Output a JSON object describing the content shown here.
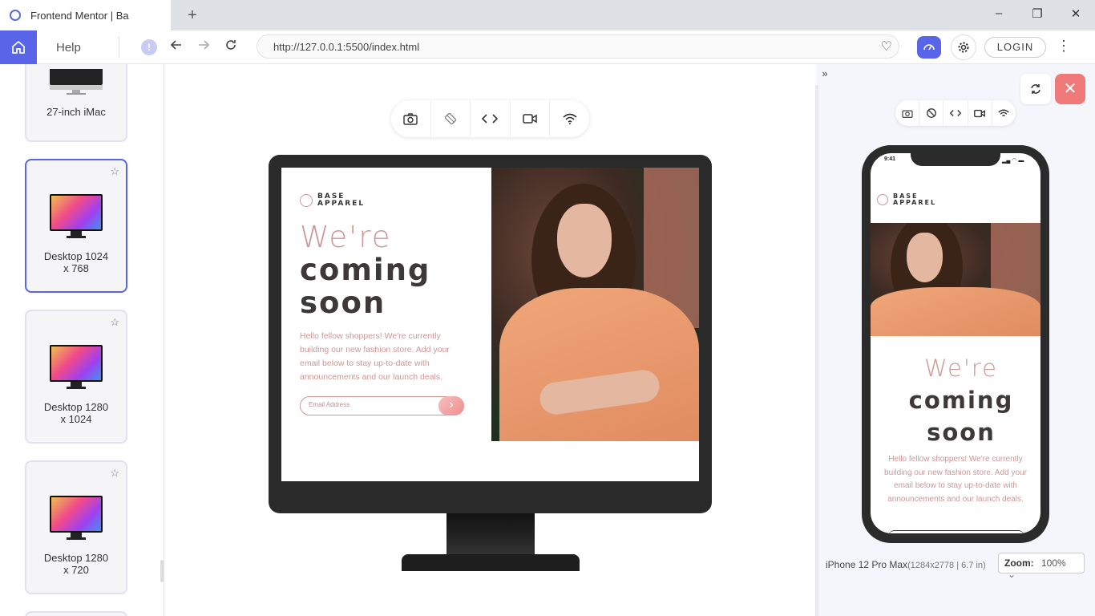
{
  "browser": {
    "tab_title": "Frontend Mentor | Ba",
    "new_tab": "+",
    "minimize": "–",
    "restore": "❐",
    "close": "✕",
    "url": "http://127.0.0.1:5500/index.html",
    "help_label": "Help",
    "login_label": "LOGIN",
    "info_glyph": "!",
    "accent": "#5865e8"
  },
  "sidebar": {
    "devices": [
      {
        "label": "27-inch iMac",
        "active": false
      },
      {
        "label": "Desktop 1024 x 768",
        "label1": "Desktop 1024",
        "label2": "x 768",
        "active": true
      },
      {
        "label": "Desktop 1280 x 1024",
        "label1": "Desktop 1280",
        "label2": "x 1024",
        "active": false
      },
      {
        "label": "Desktop 1280 x 720",
        "label1": "Desktop 1280",
        "label2": "x 720",
        "active": false
      }
    ]
  },
  "site": {
    "logo_line1": "BASE",
    "logo_line2": "APPAREL",
    "headline_pink": "We're",
    "headline_dark1": "coming",
    "headline_dark2": "soon",
    "body_text": "Hello fellow shoppers! We're currently building our new fashion store. Add your email below to stay up-to-date with announcements and our launch deals.",
    "email_placeholder": "Email Address",
    "submit_glyph": "›",
    "colors": {
      "pink": "#ce9797",
      "dark": "#3e3838",
      "button": "#f0a0a0"
    }
  },
  "phone_panel": {
    "status_time": "9:41",
    "device_name": "iPhone 12 Pro Max",
    "device_specs": "(1284x2778 | 6.7 in)",
    "zoom_label": "Zoom:",
    "zoom_value": "100%",
    "collapse_glyph": "»",
    "close_glyph": "✕"
  }
}
